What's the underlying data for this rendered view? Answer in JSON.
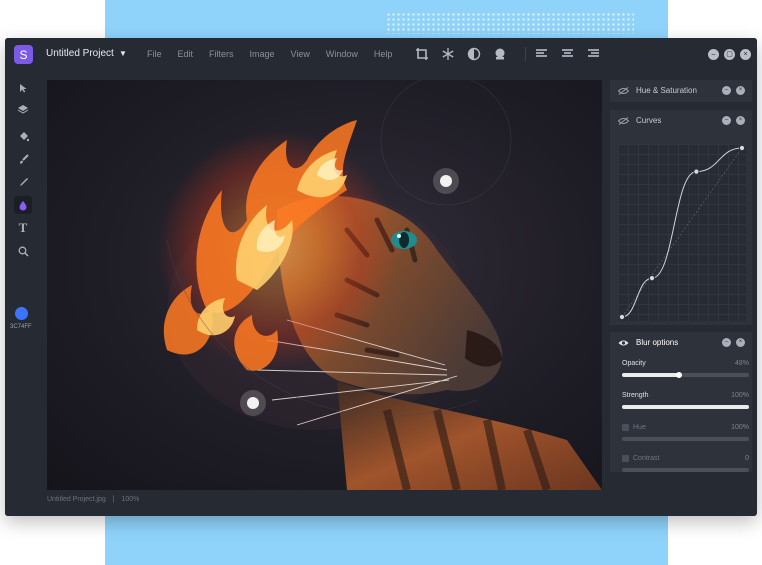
{
  "app": {
    "project_title": "Untitled Project",
    "logo_letter": "S",
    "menu": [
      "File",
      "Edit",
      "Filters",
      "Image",
      "View",
      "Window",
      "Help"
    ],
    "top_tools": [
      "crop-icon",
      "snowflake-icon",
      "contrast-icon",
      "stamp-icon"
    ],
    "align_tools": [
      "align-left-icon",
      "align-center-icon",
      "align-right-icon"
    ],
    "window_buttons": [
      "minimize-icon",
      "maximize-icon",
      "close-icon"
    ]
  },
  "left_toolbar": {
    "tools": [
      "pointer-icon",
      "layers-icon",
      "fill-bucket-icon",
      "brush-icon",
      "pen-icon",
      "drop-icon",
      "text-icon",
      "zoom-icon"
    ],
    "text_tool_glyph": "T",
    "active_tool": "drop-icon",
    "color": "#3C74FF",
    "color_label": "3C74FF",
    "more_glyph": "•••"
  },
  "status_bar": {
    "file_name": "Untitled Project.jpg",
    "separator": "|",
    "zoom": "100%"
  },
  "panels": {
    "hue_saturation": {
      "title": "Hue & Saturation"
    },
    "curves": {
      "title": "Curves",
      "points": [
        [
          0,
          0
        ],
        [
          0.25,
          0.23
        ],
        [
          0.62,
          0.86
        ],
        [
          1,
          1
        ]
      ]
    },
    "blur_options": {
      "title": "Blur options",
      "rows": [
        {
          "label": "Opacity",
          "value": "48%",
          "level": 0.45,
          "enabled": true
        },
        {
          "label": "Strength",
          "value": "100%",
          "level": 1.0,
          "enabled": true
        },
        {
          "label": "Hue",
          "value": "100%",
          "level": 0,
          "enabled": false
        },
        {
          "label": "Contrast",
          "value": "0",
          "level": 0,
          "enabled": false
        }
      ]
    }
  },
  "colors": {
    "accent": "#7B5AE6",
    "window_bg": "#262A32",
    "panel_bg": "#2E323B",
    "backdrop_blue": "#8FD3FB",
    "selected_color": "#3C74FF"
  }
}
